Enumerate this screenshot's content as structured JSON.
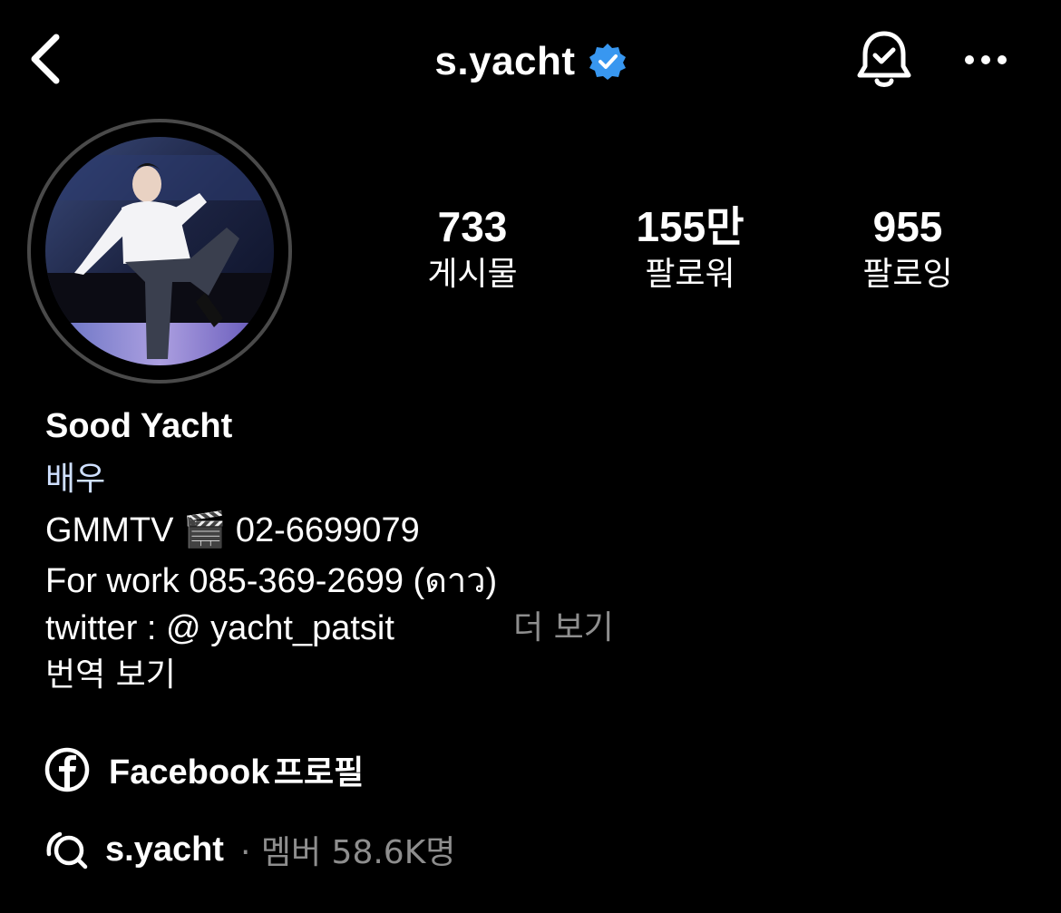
{
  "header": {
    "username": "s.yacht",
    "icons": {
      "back": "chevron-left-icon",
      "verified": "verified-badge-icon",
      "notifications": "bell-check-icon",
      "more": "more-horizontal-icon"
    },
    "verified_color": "#3897f0"
  },
  "stats": [
    {
      "value": "733",
      "label": "게시물"
    },
    {
      "value": "155만",
      "label": "팔로워"
    },
    {
      "value": "955",
      "label": "팔로잉"
    }
  ],
  "bio": {
    "name": "Sood Yacht",
    "category": "배우",
    "line_gmm": "GMMTV 🎬 02-6699079",
    "line_work": "For work 085-369-2699 (ดาว)",
    "line_twitter": "twitter : @ yacht_patsit",
    "more_label": "더 보기",
    "translate_label": "번역 보기"
  },
  "facebook": {
    "label": "Facebook",
    "suffix": "프로필",
    "icon": "facebook-icon"
  },
  "channel": {
    "name": "s.yacht",
    "meta": "· 멤버 58.6K명",
    "icon": "broadcast-channel-icon"
  }
}
